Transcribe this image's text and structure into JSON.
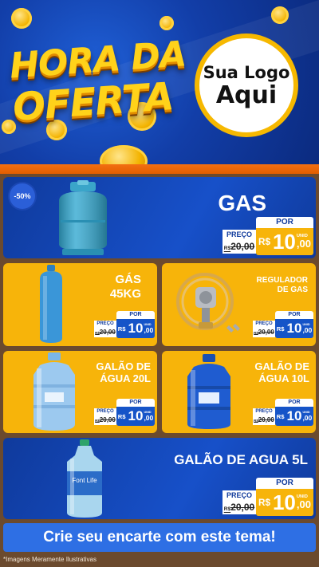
{
  "header": {
    "title_line1": "HORA DA",
    "title_line2": "OFERTA",
    "logo_line1": "Sua Logo",
    "logo_line2": "Aqui"
  },
  "products": [
    {
      "name": "GAS",
      "badge": "-50%",
      "preco_label": "PREÇO",
      "old_prefix": "R$",
      "old_price": "20,00",
      "por_label": "POR",
      "currency": "R$",
      "price_int": "10",
      "price_cents": ",00",
      "unit": "UNID"
    },
    {
      "name_1": "GÁS",
      "name_2": "45KG",
      "preco_label": "PREÇO",
      "old_prefix": "R$",
      "old_price": "20,00",
      "por_label": "POR",
      "currency": "R$",
      "price_int": "10",
      "price_cents": ",00",
      "unit": "UNID"
    },
    {
      "name_1": "REGULADOR",
      "name_2": "DE GAS",
      "preco_label": "PREÇO",
      "old_prefix": "R$",
      "old_price": "20,00",
      "por_label": "POR",
      "currency": "R$",
      "price_int": "10",
      "price_cents": ",00",
      "unit": "UNID"
    },
    {
      "name_1": "GALÃO DE",
      "name_2": "ÁGUA 20L",
      "preco_label": "PREÇO",
      "old_prefix": "R$",
      "old_price": "20,00",
      "por_label": "POR",
      "currency": "R$",
      "price_int": "10",
      "price_cents": ",00",
      "unit": "UNID"
    },
    {
      "name_1": "GALÃO DE",
      "name_2": "ÁGUA 10L",
      "preco_label": "PREÇO",
      "old_prefix": "R$",
      "old_price": "20,00",
      "por_label": "POR",
      "currency": "R$",
      "price_int": "10",
      "price_cents": ",00",
      "unit": "UNID"
    },
    {
      "name": "GALÃO DE AGUA 5L",
      "bottle_brand": "Font Life",
      "preco_label": "PREÇO",
      "old_prefix": "R$",
      "old_price": "20,00",
      "por_label": "POR",
      "currency": "R$",
      "price_int": "10",
      "price_cents": ",00",
      "unit": "UNID"
    }
  ],
  "cta_label": "Crie seu encarte com este tema!",
  "disclaimer": "*Imagens Meramente Ilustrativas",
  "colors": {
    "blue": "#1750c9",
    "yellow": "#f7b40a",
    "orange": "#f26f12",
    "wood": "#6b4a2e"
  }
}
